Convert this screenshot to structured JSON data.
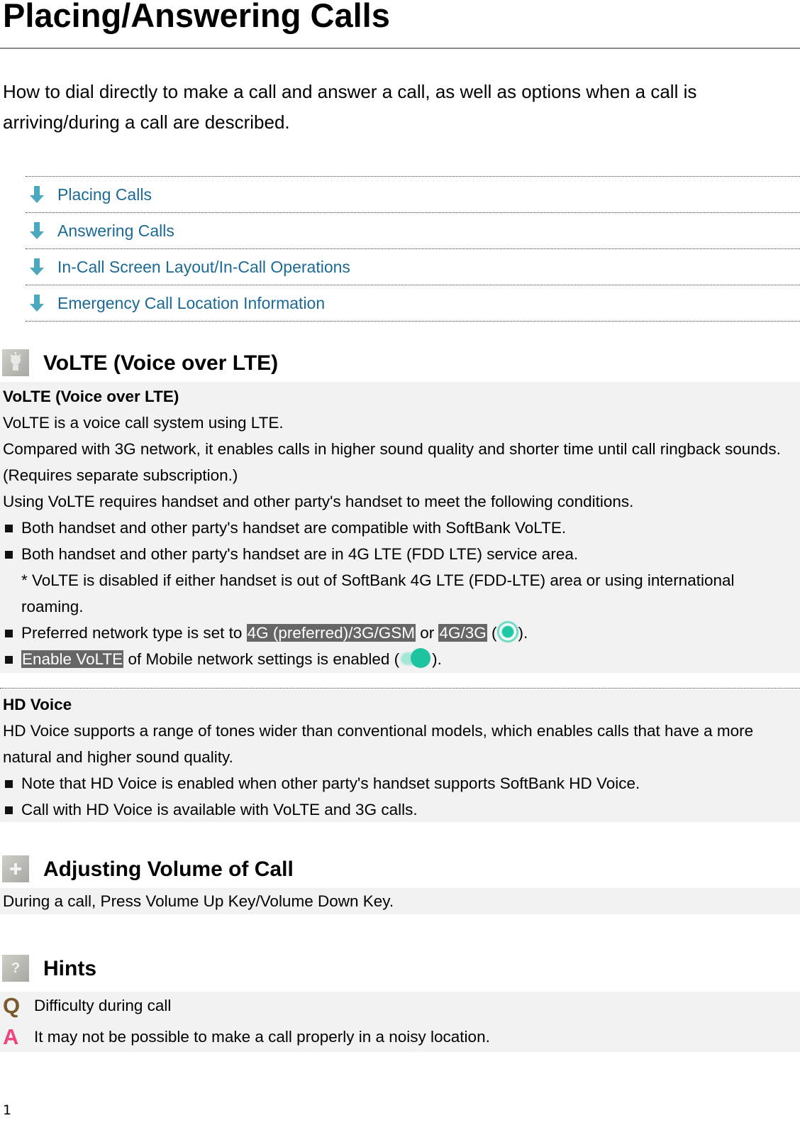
{
  "page": {
    "title": "Placing/Answering Calls",
    "intro": "How to dial directly to make a call and answer a call, as well as options when a call is arriving/during a call are described.",
    "page_number": "1"
  },
  "toc": {
    "link_color": "#1b6a96",
    "arrow_color": "#4aa9be",
    "items": [
      {
        "label": "Placing Calls",
        "icon": "arrow-down-icon"
      },
      {
        "label": "Answering Calls",
        "icon": "arrow-down-icon"
      },
      {
        "label": "In-Call Screen Layout/In-Call Operations",
        "icon": "arrow-down-icon"
      },
      {
        "label": "Emergency Call Location Information",
        "icon": "arrow-down-icon"
      }
    ]
  },
  "volte_section": {
    "icon": "lightbulb-icon",
    "heading": "VoLTE (Voice over LTE)",
    "box_title": "VoLTE (Voice over LTE)",
    "paragraphs": [
      "VoLTE is a voice call system using LTE.",
      "Compared with 3G network, it enables calls in higher sound quality and shorter time until call ringback sounds. (Requires separate subscription.)",
      "Using VoLTE requires handset and other party's handset to meet the following conditions."
    ],
    "bullets": {
      "b1": "Both handset and other party's handset are compatible with SoftBank VoLTE.",
      "b2": "Both handset and other party's handset are in 4G LTE (FDD LTE) service area.",
      "b2_note": "* VoLTE is disabled if either handset is out of SoftBank 4G LTE (FDD-LTE) area or using international roaming.",
      "b3_prefix": "Preferred network type is set to ",
      "b3_hl1": "4G (preferred)/3G/GSM",
      "b3_mid": " or ",
      "b3_hl2": "4G/3G",
      "b3_open": " (",
      "b3_icon": "radio-selected-icon",
      "b3_close": ").",
      "b4_hl": "Enable VoLTE",
      "b4_text": " of Mobile network settings is enabled (",
      "b4_icon": "toggle-on-icon",
      "b4_close": ")."
    }
  },
  "hd_voice": {
    "title": "HD Voice",
    "paragraph": "HD Voice supports a range of tones wider than conventional models, which enables calls that have a more natural and higher sound quality.",
    "bullets": [
      "Note that HD Voice is enabled when other party's handset supports SoftBank HD Voice.",
      "Call with HD Voice is available with VoLTE and 3G calls."
    ]
  },
  "volume_section": {
    "icon": "plus-icon",
    "heading": "Adjusting Volume of Call",
    "text": "During a call, Press Volume Up Key/Volume Down Key."
  },
  "hints_section": {
    "icon": "question-icon",
    "heading": "Hints",
    "q_letter": "Q",
    "q_color": "#7a5a2a",
    "question": "Difficulty during call",
    "a_letter": "A",
    "a_color": "#f0447c",
    "answer": "It may not be possible to make a call properly in a noisy location."
  }
}
